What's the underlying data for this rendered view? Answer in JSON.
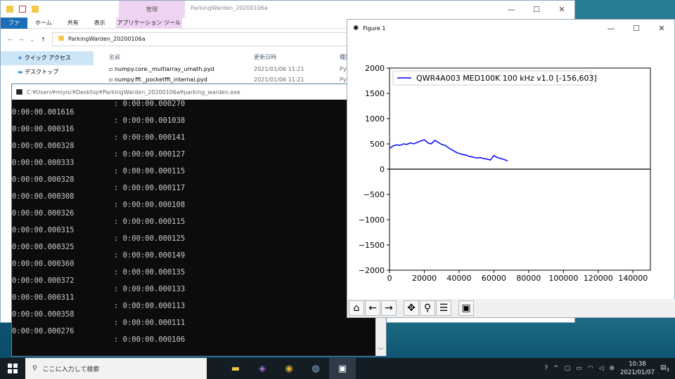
{
  "explorer": {
    "context_tab": "管理",
    "title": "ParkingWarden_20200106a",
    "ribbon": {
      "file": "ファイル",
      "home": "ホーム",
      "share": "共有",
      "view": "表示",
      "tools": "アプリケーション ツール"
    },
    "path": "ParkingWarden_20200106a",
    "nav": [
      {
        "label": "クイック アクセス"
      },
      {
        "label": "デスクトップ"
      }
    ],
    "columns": {
      "name": "名前",
      "date": "更新日時",
      "type": "種類"
    },
    "files": [
      {
        "name": "numpy.core._multiarray_umath.pyd",
        "date": "2021/01/06 11:21",
        "type": "Pyt"
      },
      {
        "name": "numpy.fft._pocketfft_internal.pyd",
        "date": "2021/01/06 11:21",
        "type": "Pyt"
      }
    ]
  },
  "console": {
    "title": "C:¥Users¥miyoc¥Desktop¥ParkingWarden_20200106a¥parking_warden.exe",
    "left": [
      "0:00:00.001616",
      "0:00:00.000316",
      "0:00:00.000328",
      "0:00:00.000333",
      "0:00:00.000328",
      "0:00:00.000308",
      "0:00:00.000326",
      "0:00:00.000315",
      "0:00:00.000325",
      "0:00:00.000360",
      "0:00:00.000372",
      "0:00:00.000311",
      "0:00:00.000358",
      "0:00:00.000276"
    ],
    "right": [
      ": 0:00:00.000270",
      ": 0:00:00.001038",
      ": 0:00:00.000141",
      ": 0:00:00.000127",
      ": 0:00:00.000115",
      ": 0:00:00.000117",
      ": 0:00:00.000108",
      ": 0:00:00.000115",
      ": 0:00:00.000125",
      ": 0:00:00.000149",
      ": 0:00:00.000135",
      ": 0:00:00.000133",
      ": 0:00:00.000113",
      ": 0:00:00.000111",
      ": 0:00:00.000106"
    ]
  },
  "figure": {
    "title": "Figure 1"
  },
  "chart_data": {
    "type": "line",
    "title": "",
    "xlim": [
      0,
      150000
    ],
    "ylim": [
      -2000,
      2000
    ],
    "xticks": [
      0,
      20000,
      40000,
      60000,
      80000,
      100000,
      120000,
      140000
    ],
    "yticks": [
      2000,
      1500,
      1000,
      500,
      0,
      -500,
      -1000,
      -1500,
      -2000
    ],
    "xtick_labels": [
      "0",
      "20000",
      "40000",
      "60000",
      "80000",
      "100000",
      "120000",
      "140000"
    ],
    "ytick_labels": [
      "2000",
      "1500",
      "1000",
      "500",
      "0",
      "−500",
      "−1000",
      "−1500",
      "−2000"
    ],
    "legend_position": "top-left",
    "series": [
      {
        "name": "QWR4A003 MED100K 100 kHz v1.0 [-156,603]",
        "color": "#0000ff",
        "x": [
          0,
          2000,
          4000,
          6000,
          8000,
          10000,
          12000,
          14000,
          16000,
          18000,
          20000,
          22000,
          24000,
          26000,
          28000,
          30000,
          32000,
          34000,
          36000,
          38000,
          40000,
          42000,
          44000,
          46000,
          48000,
          50000,
          52000,
          54000,
          56000,
          58000,
          60000,
          62000,
          64000,
          66000,
          68000
        ],
        "y": [
          410,
          460,
          480,
          470,
          500,
          490,
          520,
          500,
          530,
          560,
          580,
          520,
          500,
          570,
          530,
          490,
          470,
          420,
          380,
          340,
          310,
          290,
          280,
          250,
          240,
          220,
          230,
          210,
          200,
          180,
          270,
          230,
          210,
          190,
          160
        ]
      },
      {
        "name": "",
        "color": "#000000",
        "x": [
          0,
          150000
        ],
        "y": [
          0,
          0
        ]
      }
    ]
  },
  "taskbar": {
    "search": "ここに入力して検索",
    "time": "10:38",
    "date": "2021/01/07",
    "notif": "3"
  }
}
